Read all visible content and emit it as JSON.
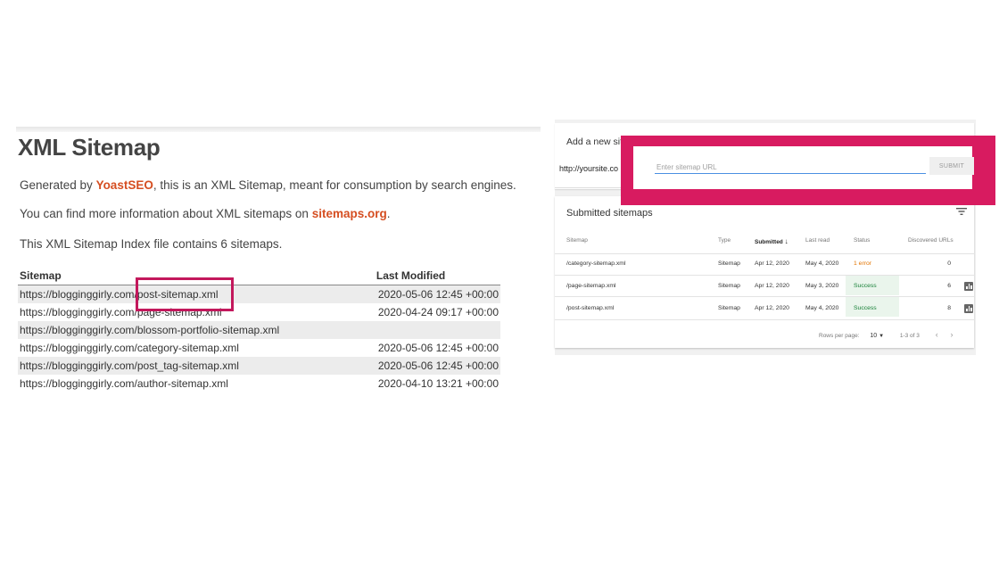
{
  "left": {
    "title": "XML Sitemap",
    "intro": {
      "line1_prefix": "Generated by ",
      "line1_link": "YoastSEO",
      "line1_suffix": ", this is an XML Sitemap, meant for consumption by search engines.",
      "line2_prefix": "You can find more information about XML sitemaps on ",
      "line2_link": "sitemaps.org",
      "line2_suffix": ".",
      "line3": "This XML Sitemap Index file contains 6 sitemaps."
    },
    "table": {
      "col_sitemap": "Sitemap",
      "col_modified": "Last Modified",
      "rows": [
        {
          "url": "https://blogginggirly.com/post-sitemap.xml",
          "modified": "2020-05-06 12:45 +00:00"
        },
        {
          "url": "https://blogginggirly.com/page-sitemap.xml",
          "modified": "2020-04-24 09:17 +00:00"
        },
        {
          "url": "https://blogginggirly.com/blossom-portfolio-sitemap.xml",
          "modified": ""
        },
        {
          "url": "https://blogginggirly.com/category-sitemap.xml",
          "modified": "2020-05-06 12:45 +00:00"
        },
        {
          "url": "https://blogginggirly.com/post_tag-sitemap.xml",
          "modified": "2020-05-06 12:45 +00:00"
        },
        {
          "url": "https://blogginggirly.com/author-sitemap.xml",
          "modified": "2020-04-10 13:21 +00:00"
        }
      ]
    }
  },
  "right": {
    "add_title": "Add a new sit",
    "url_prefix": "http://yoursite.co",
    "input_placeholder": "Enter sitemap URL",
    "submit_label": "SUBMIT",
    "submitted_title": "Submitted sitemaps",
    "headers": {
      "sitemap": "Sitemap",
      "type": "Type",
      "submitted": "Submitted",
      "last_read": "Last read",
      "status": "Status",
      "discovered": "Discovered URLs"
    },
    "rows": [
      {
        "sitemap": "/category-sitemap.xml",
        "type": "Sitemap",
        "submitted": "Apr 12, 2020",
        "last_read": "May 4, 2020",
        "status": "1 error",
        "discovered": "0"
      },
      {
        "sitemap": "/page-sitemap.xml",
        "type": "Sitemap",
        "submitted": "Apr 12, 2020",
        "last_read": "May 3, 2020",
        "status": "Success",
        "discovered": "6"
      },
      {
        "sitemap": "/post-sitemap.xml",
        "type": "Sitemap",
        "submitted": "Apr 12, 2020",
        "last_read": "May 4, 2020",
        "status": "Success",
        "discovered": "8"
      }
    ],
    "pager": {
      "rows_label": "Rows per page:",
      "rows_value": "10",
      "range": "1-3 of 3"
    }
  },
  "colors": {
    "highlight": "#d81b60",
    "link": "#d54e21",
    "error": "#e37400",
    "success": "#188038"
  }
}
